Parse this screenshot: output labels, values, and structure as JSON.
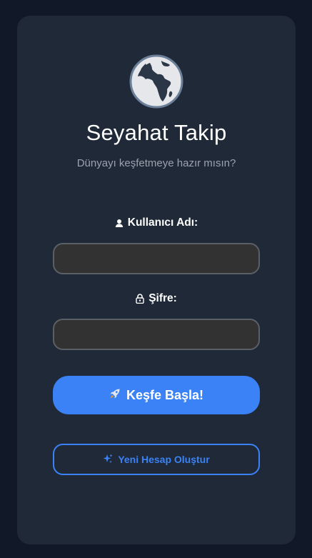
{
  "app": {
    "title": "Seyahat Takip",
    "subtitle": "Dünyayı keşfetmeye hazır mısın?"
  },
  "form": {
    "username": {
      "label": "Kullanıcı Adı:",
      "icon": "user-icon",
      "value": ""
    },
    "password": {
      "label": "Şifre:",
      "icon": "lock-icon",
      "value": ""
    },
    "submit_label": "Keşfe Başla!",
    "submit_icon": "rocket-icon",
    "register_label": "Yeni Hesap Oluştur",
    "register_icon": "sparkle-icon"
  },
  "colors": {
    "page_bg": "#111827",
    "card_bg": "#1f2937",
    "accent": "#3b82f6",
    "input_bg": "#323232",
    "muted_text": "#9ca3af"
  },
  "logo_icon": "globe-africa-icon"
}
